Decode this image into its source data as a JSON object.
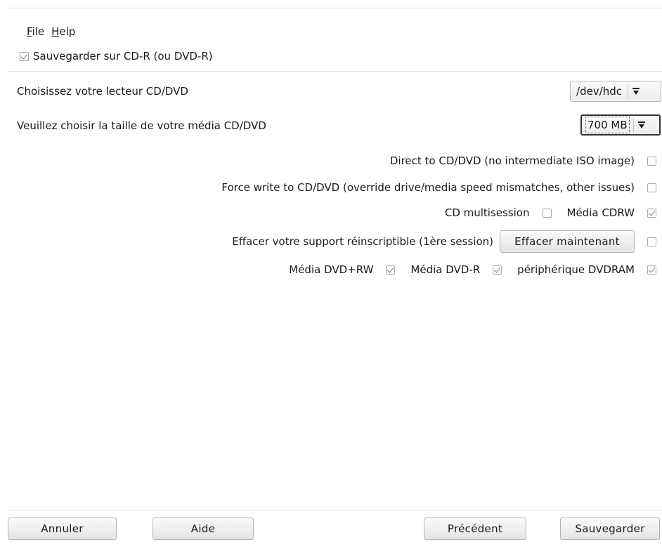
{
  "menu": {
    "file": {
      "mnemonic": "F",
      "rest": "ile"
    },
    "help": {
      "mnemonic": "H",
      "rest": "elp"
    }
  },
  "save_to_cd": {
    "label": "Sauvegarder sur CD-R (ou DVD-R)",
    "checked": true
  },
  "drive": {
    "label": "Choisissez votre lecteur CD/DVD",
    "value": "/dev/hdc"
  },
  "media_size": {
    "label": "Veuillez choisir la taille de votre média CD/DVD",
    "value": "700 MB"
  },
  "options": {
    "direct": {
      "label": "Direct to CD/DVD (no intermediate ISO image)",
      "checked": false
    },
    "force": {
      "label": "Force write to CD/DVD (override drive/media speed mismatches, other issues)",
      "checked": false
    },
    "multisession": {
      "label": "CD multisession",
      "checked": false
    },
    "cdrw": {
      "label": "Média CDRW",
      "checked": true
    },
    "erase": {
      "label": "Effacer votre support réinscriptible (1ère session)",
      "button": "Effacer maintenant",
      "checked": false
    },
    "dvdrw": {
      "label": "Média DVD+RW",
      "checked": true
    },
    "dvdr": {
      "label": "Média DVD-R",
      "checked": true
    },
    "dvdram": {
      "label": "périphérique DVDRAM",
      "checked": true
    }
  },
  "buttons": {
    "cancel": "Annuler",
    "help": "Aide",
    "previous": "Précédent",
    "save": "Sauvegarder"
  }
}
